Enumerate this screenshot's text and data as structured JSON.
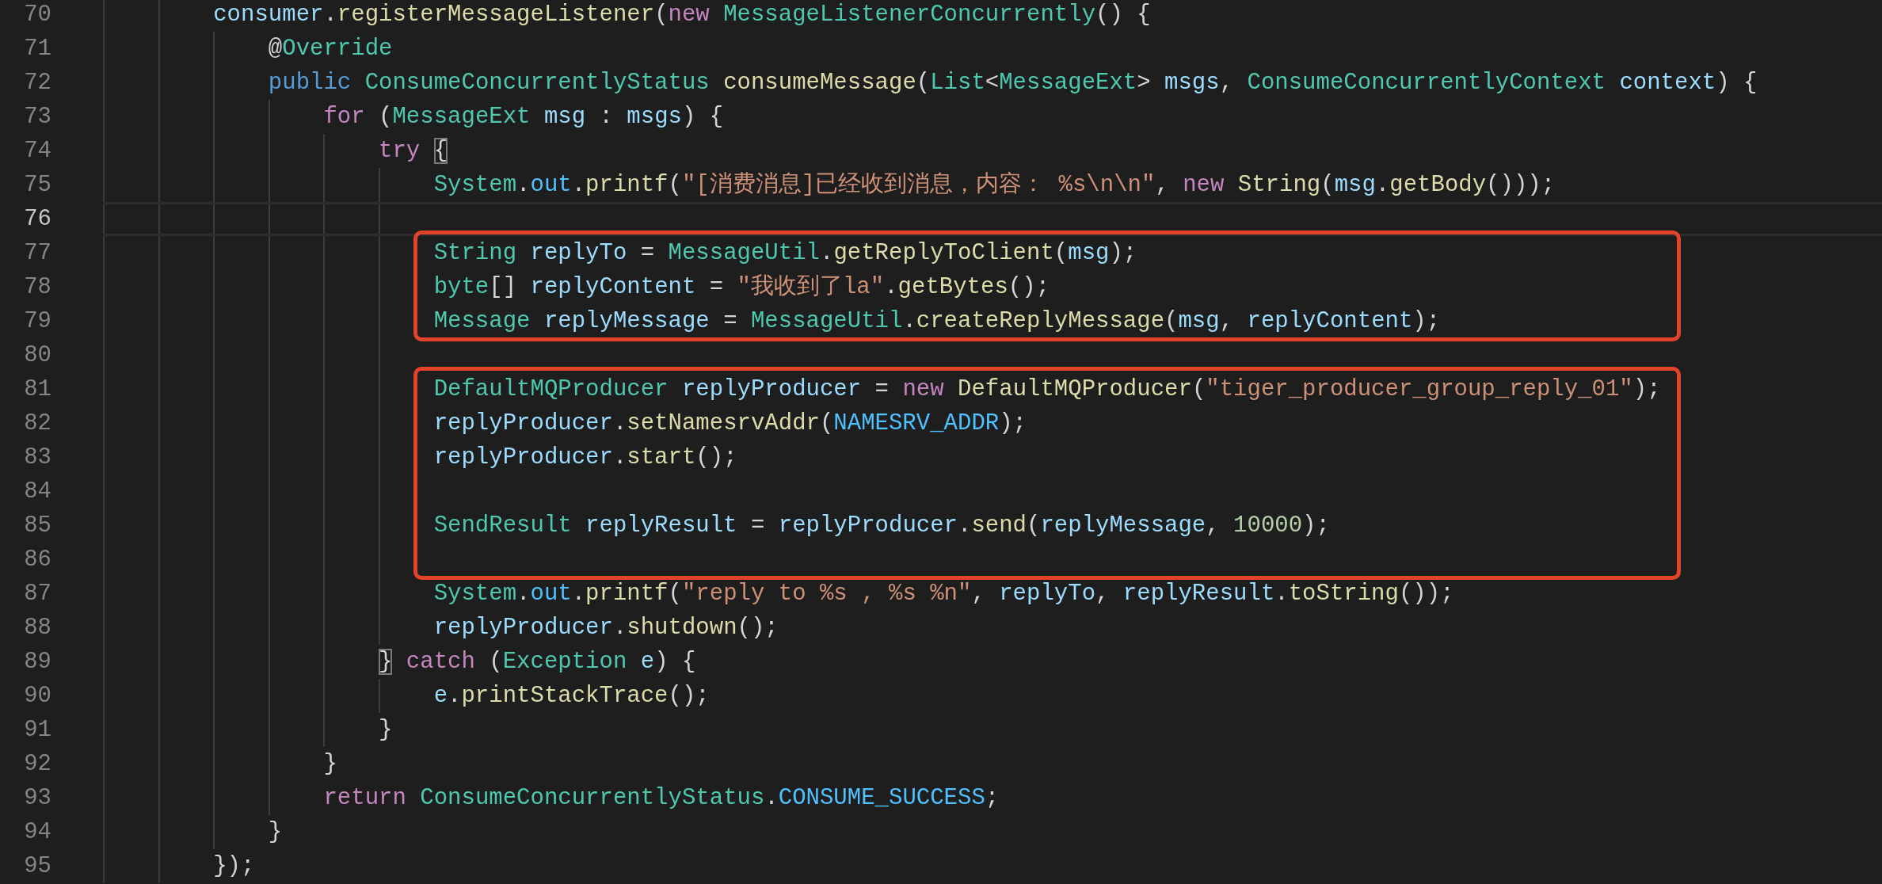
{
  "editor": {
    "lines": [
      {
        "kind": "line",
        "number": "70",
        "current": false,
        "tokens": [
          {
            "kind": "v",
            "text": "consumer"
          },
          {
            "kind": "p",
            "text": "."
          },
          {
            "kind": "f",
            "text": "registerMessageListener"
          },
          {
            "kind": "p",
            "text": "("
          },
          {
            "kind": "k",
            "text": "new "
          },
          {
            "kind": "t",
            "text": "MessageListenerConcurrently"
          },
          {
            "kind": "p",
            "text": "() {"
          }
        ],
        "children": [
          {
            "kind": "line",
            "number": "71",
            "current": false,
            "tokens": [
              {
                "kind": "p",
                "text": "@"
              },
              {
                "kind": "t",
                "text": "Override"
              }
            ]
          },
          {
            "kind": "line",
            "number": "72",
            "current": false,
            "tokens": [
              {
                "kind": "b",
                "text": "public "
              },
              {
                "kind": "t",
                "text": "ConsumeConcurrentlyStatus "
              },
              {
                "kind": "f",
                "text": "consumeMessage"
              },
              {
                "kind": "p",
                "text": "("
              },
              {
                "kind": "t",
                "text": "List"
              },
              {
                "kind": "p",
                "text": "<"
              },
              {
                "kind": "t",
                "text": "MessageExt"
              },
              {
                "kind": "p",
                "text": "> "
              },
              {
                "kind": "v",
                "text": "msgs"
              },
              {
                "kind": "p",
                "text": ", "
              },
              {
                "kind": "t",
                "text": "ConsumeConcurrentlyContext "
              },
              {
                "kind": "v",
                "text": "context"
              },
              {
                "kind": "p",
                "text": ") {"
              }
            ],
            "children": [
              {
                "kind": "line",
                "number": "73",
                "current": false,
                "tokens": [
                  {
                    "kind": "k",
                    "text": "for"
                  },
                  {
                    "kind": "p",
                    "text": " ("
                  },
                  {
                    "kind": "t",
                    "text": "MessageExt "
                  },
                  {
                    "kind": "v",
                    "text": "msg"
                  },
                  {
                    "kind": "p",
                    "text": " : "
                  },
                  {
                    "kind": "v",
                    "text": "msgs"
                  },
                  {
                    "kind": "p",
                    "text": ") {"
                  }
                ],
                "children": [
                  {
                    "kind": "line",
                    "number": "74",
                    "current": false,
                    "tokens": [
                      {
                        "kind": "k",
                        "text": "try "
                      },
                      {
                        "kind": "m",
                        "text": "{"
                      }
                    ],
                    "children": [
                      {
                        "kind": "line",
                        "number": "75",
                        "current": false,
                        "tokens": [
                          {
                            "kind": "t",
                            "text": "System"
                          },
                          {
                            "kind": "p",
                            "text": "."
                          },
                          {
                            "kind": "c",
                            "text": "out"
                          },
                          {
                            "kind": "p",
                            "text": "."
                          },
                          {
                            "kind": "f",
                            "text": "printf"
                          },
                          {
                            "kind": "p",
                            "text": "("
                          },
                          {
                            "kind": "s",
                            "text": "\"[消费消息]已经收到消息，内容： %s\\n\\n\""
                          },
                          {
                            "kind": "p",
                            "text": ", "
                          },
                          {
                            "kind": "k",
                            "text": "new "
                          },
                          {
                            "kind": "f",
                            "text": "String"
                          },
                          {
                            "kind": "p",
                            "text": "("
                          },
                          {
                            "kind": "v",
                            "text": "msg"
                          },
                          {
                            "kind": "p",
                            "text": "."
                          },
                          {
                            "kind": "f",
                            "text": "getBody"
                          },
                          {
                            "kind": "p",
                            "text": "()));"
                          }
                        ]
                      },
                      {
                        "kind": "line",
                        "number": "76",
                        "current": true
                      },
                      {
                        "kind": "boxed",
                        "lines": [
                          {
                            "kind": "line",
                            "number": "77",
                            "current": false,
                            "tokens": [
                              {
                                "kind": "t",
                                "text": "String "
                              },
                              {
                                "kind": "v",
                                "text": "replyTo"
                              },
                              {
                                "kind": "p",
                                "text": " = "
                              },
                              {
                                "kind": "t",
                                "text": "MessageUtil"
                              },
                              {
                                "kind": "p",
                                "text": "."
                              },
                              {
                                "kind": "f",
                                "text": "getReplyToClient"
                              },
                              {
                                "kind": "p",
                                "text": "("
                              },
                              {
                                "kind": "v",
                                "text": "msg"
                              },
                              {
                                "kind": "p",
                                "text": ");"
                              }
                            ]
                          },
                          {
                            "kind": "line",
                            "number": "78",
                            "current": false,
                            "tokens": [
                              {
                                "kind": "t",
                                "text": "byte"
                              },
                              {
                                "kind": "p",
                                "text": "[] "
                              },
                              {
                                "kind": "v",
                                "text": "replyContent"
                              },
                              {
                                "kind": "p",
                                "text": " = "
                              },
                              {
                                "kind": "s",
                                "text": "\"我收到了la\""
                              },
                              {
                                "kind": "p",
                                "text": "."
                              },
                              {
                                "kind": "f",
                                "text": "getBytes"
                              },
                              {
                                "kind": "p",
                                "text": "();"
                              }
                            ]
                          },
                          {
                            "kind": "line",
                            "number": "79",
                            "current": false,
                            "tokens": [
                              {
                                "kind": "t",
                                "text": "Message "
                              },
                              {
                                "kind": "v",
                                "text": "replyMessage"
                              },
                              {
                                "kind": "p",
                                "text": " = "
                              },
                              {
                                "kind": "t",
                                "text": "MessageUtil"
                              },
                              {
                                "kind": "p",
                                "text": "."
                              },
                              {
                                "kind": "f",
                                "text": "createReplyMessage"
                              },
                              {
                                "kind": "p",
                                "text": "("
                              },
                              {
                                "kind": "v",
                                "text": "msg"
                              },
                              {
                                "kind": "p",
                                "text": ", "
                              },
                              {
                                "kind": "v",
                                "text": "replyContent"
                              },
                              {
                                "kind": "p",
                                "text": ");"
                              }
                            ]
                          }
                        ]
                      },
                      {
                        "kind": "line",
                        "number": "80",
                        "current": false
                      },
                      {
                        "kind": "boxed",
                        "lines": [
                          {
                            "kind": "line",
                            "number": "81",
                            "current": false,
                            "tokens": [
                              {
                                "kind": "t",
                                "text": "DefaultMQProducer "
                              },
                              {
                                "kind": "v",
                                "text": "replyProducer"
                              },
                              {
                                "kind": "p",
                                "text": " = "
                              },
                              {
                                "kind": "k",
                                "text": "new "
                              },
                              {
                                "kind": "f",
                                "text": "DefaultMQProducer"
                              },
                              {
                                "kind": "p",
                                "text": "("
                              },
                              {
                                "kind": "s",
                                "text": "\"tiger_producer_group_reply_01\""
                              },
                              {
                                "kind": "p",
                                "text": ");"
                              }
                            ]
                          },
                          {
                            "kind": "line",
                            "number": "82",
                            "current": false,
                            "tokens": [
                              {
                                "kind": "v",
                                "text": "replyProducer"
                              },
                              {
                                "kind": "p",
                                "text": "."
                              },
                              {
                                "kind": "f",
                                "text": "setNamesrvAddr"
                              },
                              {
                                "kind": "p",
                                "text": "("
                              },
                              {
                                "kind": "c",
                                "text": "NAMESRV_ADDR"
                              },
                              {
                                "kind": "p",
                                "text": ");"
                              }
                            ]
                          },
                          {
                            "kind": "line",
                            "number": "83",
                            "current": false,
                            "tokens": [
                              {
                                "kind": "v",
                                "text": "replyProducer"
                              },
                              {
                                "kind": "p",
                                "text": "."
                              },
                              {
                                "kind": "f",
                                "text": "start"
                              },
                              {
                                "kind": "p",
                                "text": "();"
                              }
                            ]
                          },
                          {
                            "kind": "line",
                            "number": "84",
                            "current": false
                          },
                          {
                            "kind": "line",
                            "number": "85",
                            "current": false,
                            "tokens": [
                              {
                                "kind": "t",
                                "text": "SendResult "
                              },
                              {
                                "kind": "v",
                                "text": "replyResult"
                              },
                              {
                                "kind": "p",
                                "text": " = "
                              },
                              {
                                "kind": "v",
                                "text": "replyProducer"
                              },
                              {
                                "kind": "p",
                                "text": "."
                              },
                              {
                                "kind": "f",
                                "text": "send"
                              },
                              {
                                "kind": "p",
                                "text": "("
                              },
                              {
                                "kind": "v",
                                "text": "replyMessage"
                              },
                              {
                                "kind": "p",
                                "text": ", "
                              },
                              {
                                "kind": "n",
                                "text": "10000"
                              },
                              {
                                "kind": "p",
                                "text": ");"
                              }
                            ]
                          },
                          {
                            "kind": "line",
                            "number": "86",
                            "current": false
                          }
                        ]
                      },
                      {
                        "kind": "line",
                        "number": "87",
                        "current": false,
                        "tokens": [
                          {
                            "kind": "t",
                            "text": "System"
                          },
                          {
                            "kind": "p",
                            "text": "."
                          },
                          {
                            "kind": "c",
                            "text": "out"
                          },
                          {
                            "kind": "p",
                            "text": "."
                          },
                          {
                            "kind": "f",
                            "text": "printf"
                          },
                          {
                            "kind": "p",
                            "text": "("
                          },
                          {
                            "kind": "s",
                            "text": "\"reply to %s , %s %n\""
                          },
                          {
                            "kind": "p",
                            "text": ", "
                          },
                          {
                            "kind": "v",
                            "text": "replyTo"
                          },
                          {
                            "kind": "p",
                            "text": ", "
                          },
                          {
                            "kind": "v",
                            "text": "replyResult"
                          },
                          {
                            "kind": "p",
                            "text": "."
                          },
                          {
                            "kind": "f",
                            "text": "toString"
                          },
                          {
                            "kind": "p",
                            "text": "());"
                          }
                        ]
                      },
                      {
                        "kind": "line",
                        "number": "88",
                        "current": false,
                        "tokens": [
                          {
                            "kind": "v",
                            "text": "replyProducer"
                          },
                          {
                            "kind": "p",
                            "text": "."
                          },
                          {
                            "kind": "f",
                            "text": "shutdown"
                          },
                          {
                            "kind": "p",
                            "text": "();"
                          }
                        ]
                      }
                    ]
                  },
                  {
                    "kind": "line",
                    "number": "89",
                    "current": false,
                    "tokens": [
                      {
                        "kind": "m",
                        "text": "}"
                      },
                      {
                        "kind": "k",
                        "text": " catch"
                      },
                      {
                        "kind": "p",
                        "text": " ("
                      },
                      {
                        "kind": "t",
                        "text": "Exception "
                      },
                      {
                        "kind": "v",
                        "text": "e"
                      },
                      {
                        "kind": "p",
                        "text": ") {"
                      }
                    ],
                    "children": [
                      {
                        "kind": "line",
                        "number": "90",
                        "current": false,
                        "tokens": [
                          {
                            "kind": "v",
                            "text": "e"
                          },
                          {
                            "kind": "p",
                            "text": "."
                          },
                          {
                            "kind": "f",
                            "text": "printStackTrace"
                          },
                          {
                            "kind": "p",
                            "text": "();"
                          }
                        ]
                      }
                    ]
                  },
                  {
                    "kind": "line",
                    "number": "91",
                    "current": false,
                    "tokens": [
                      {
                        "kind": "p",
                        "text": "}"
                      }
                    ]
                  }
                ]
              },
              {
                "kind": "line",
                "number": "92",
                "current": false,
                "tokens": [
                  {
                    "kind": "p",
                    "text": "}"
                  }
                ]
              },
              {
                "kind": "line",
                "number": "93",
                "current": false,
                "tokens": [
                  {
                    "kind": "k",
                    "text": "return "
                  },
                  {
                    "kind": "t",
                    "text": "ConsumeConcurrentlyStatus"
                  },
                  {
                    "kind": "p",
                    "text": "."
                  },
                  {
                    "kind": "c",
                    "text": "CONSUME_SUCCESS"
                  },
                  {
                    "kind": "p",
                    "text": ";"
                  }
                ]
              }
            ]
          },
          {
            "kind": "line",
            "number": "94",
            "current": false,
            "tokens": [
              {
                "kind": "p",
                "text": "}"
              }
            ]
          }
        ]
      },
      {
        "kind": "line",
        "number": "95",
        "current": false,
        "tokens": [
          {
            "kind": "p",
            "text": "});"
          }
        ]
      }
    ]
  }
}
